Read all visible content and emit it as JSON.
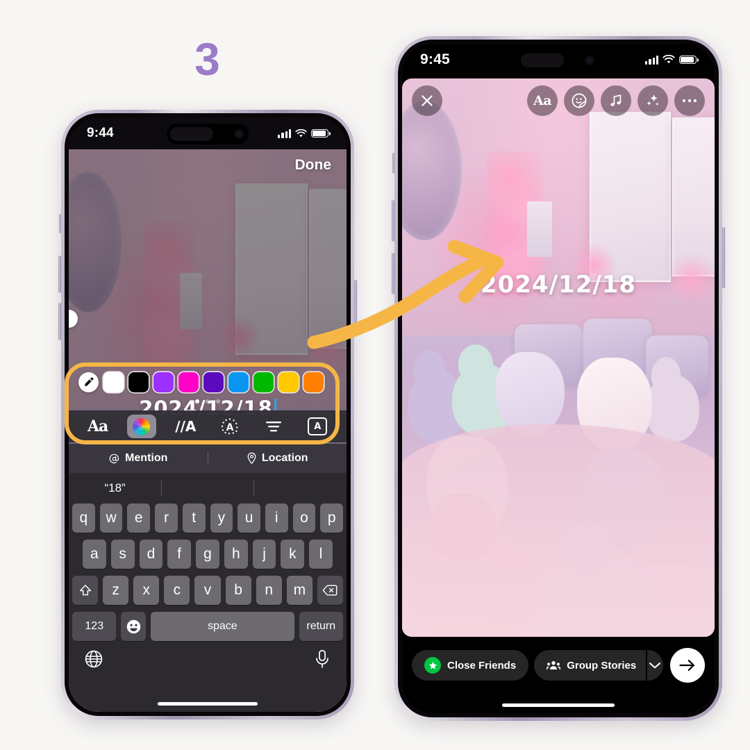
{
  "step": {
    "number": "3",
    "color": "#9b7cc8"
  },
  "annotation": {
    "arrow_color": "#f5b646",
    "highlight_color": "#f5b646"
  },
  "phone_left": {
    "status_bar": {
      "time": "9:44",
      "signal_icon": "cellular-bars-icon",
      "wifi_icon": "wifi-icon",
      "battery_icon": "battery-icon"
    },
    "done_label": "Done",
    "overlay_text": "2024/12/18",
    "color_swatches": [
      {
        "name": "eyedropper",
        "hex": "#ffffff"
      },
      {
        "name": "white",
        "hex": "#ffffff"
      },
      {
        "name": "black",
        "hex": "#000000"
      },
      {
        "name": "purple",
        "hex": "#9b30ff"
      },
      {
        "name": "magenta",
        "hex": "#ff00c8"
      },
      {
        "name": "deep-purple",
        "hex": "#5b0bbd"
      },
      {
        "name": "blue",
        "hex": "#0a96f0"
      },
      {
        "name": "green",
        "hex": "#00b800"
      },
      {
        "name": "yellow",
        "hex": "#ffc800"
      },
      {
        "name": "orange",
        "hex": "#ff8000"
      }
    ],
    "page_dots": {
      "count": 3,
      "active_index": 0
    },
    "tools": [
      {
        "name": "font-style",
        "glyph": "Aa",
        "active": false
      },
      {
        "name": "color-wheel",
        "glyph": "",
        "active": true
      },
      {
        "name": "text-effect",
        "glyph": "//A",
        "active": false
      },
      {
        "name": "text-glow",
        "glyph": "A",
        "active": false
      },
      {
        "name": "text-align",
        "glyph": "",
        "active": false
      },
      {
        "name": "text-highlight",
        "glyph": "A",
        "active": false
      }
    ],
    "mention_label": "Mention",
    "location_label": "Location",
    "keyboard": {
      "suggestion": "“18”",
      "row1": [
        "q",
        "w",
        "e",
        "r",
        "t",
        "y",
        "u",
        "i",
        "o",
        "p"
      ],
      "row2": [
        "a",
        "s",
        "d",
        "f",
        "g",
        "h",
        "j",
        "k",
        "l"
      ],
      "row3": [
        "z",
        "x",
        "c",
        "v",
        "b",
        "n",
        "m"
      ],
      "shift_icon": "shift-icon",
      "backspace_icon": "backspace-icon",
      "numbers_key": "123",
      "emoji_icon": "emoji-icon",
      "space_key": "space",
      "return_key": "return",
      "globe_icon": "globe-icon",
      "mic_icon": "microphone-icon"
    }
  },
  "phone_right": {
    "status_bar": {
      "time": "9:45",
      "signal_icon": "cellular-bars-icon",
      "wifi_icon": "wifi-icon",
      "battery_icon": "battery-icon"
    },
    "overlay_text": "2024/12/18",
    "top_actions": [
      {
        "name": "close",
        "glyph": "✕"
      },
      {
        "name": "text",
        "glyph": "Aa"
      },
      {
        "name": "sticker",
        "glyph": ""
      },
      {
        "name": "music",
        "glyph": "♫"
      },
      {
        "name": "effects",
        "glyph": ""
      },
      {
        "name": "more",
        "glyph": "⋯"
      }
    ],
    "bottom_actions": {
      "close_friends_label": "Close Friends",
      "group_stories_label": "Group Stories",
      "chevron_icon": "chevron-down-icon",
      "send_icon": "arrow-right-icon",
      "close_friends_color": "#00c642"
    }
  }
}
